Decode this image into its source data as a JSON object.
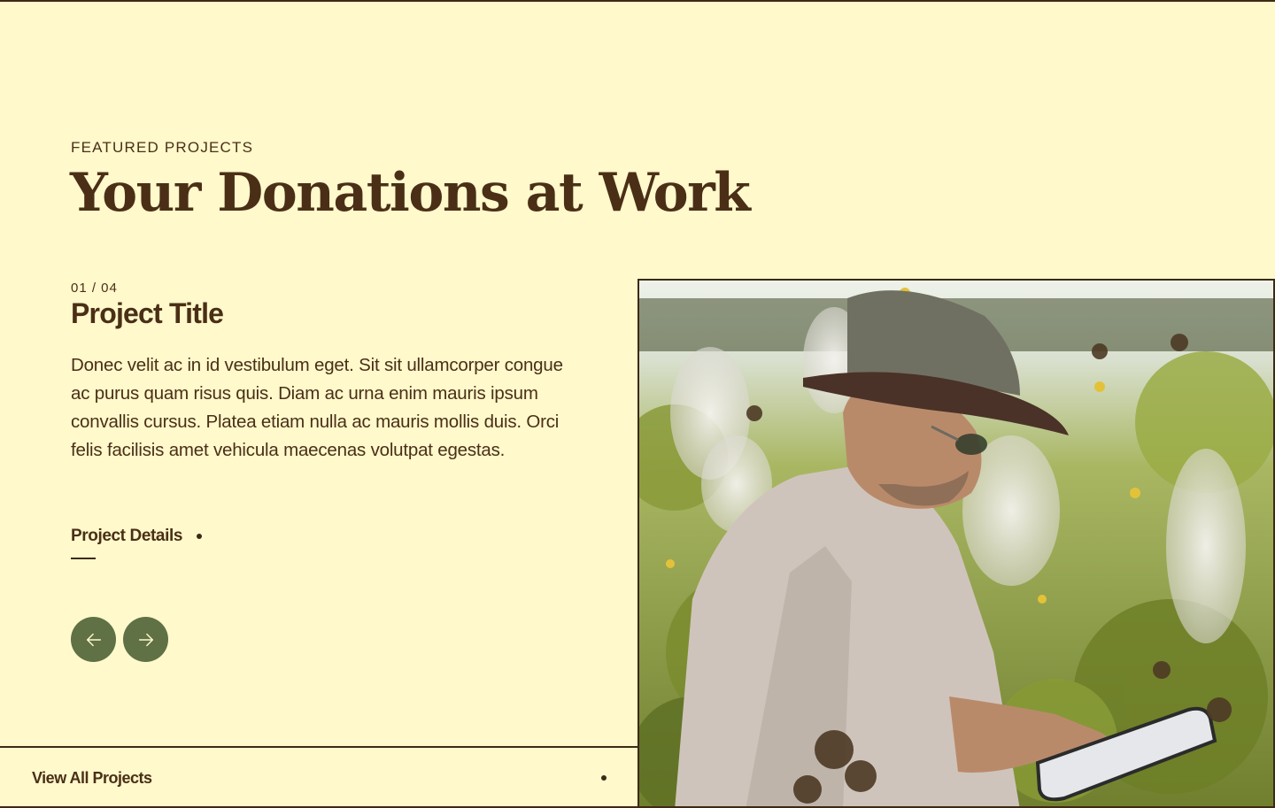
{
  "section": {
    "eyebrow": "FEATURED PROJECTS",
    "headline": "Your Donations at Work"
  },
  "project": {
    "counter": "01 / 04",
    "title": "Project Title",
    "body": "Donec velit ac in id vestibulum eget. Sit sit ullamcorper congue ac purus quam risus quis. Diam ac urna enim mauris ipsum convallis cursus. Platea etiam nulla ac mauris mollis duis. Orci felis facilisis amet vehicula maecenas volutpat egestas.",
    "details_label": "Project Details"
  },
  "carousel": {
    "prev_icon": "arrow-left-icon",
    "next_icon": "arrow-right-icon"
  },
  "footer": {
    "view_all_label": "View All Projects"
  },
  "colors": {
    "background": "#fff9cc",
    "text": "#4a2f16",
    "accent_green": "#5f7145",
    "rule": "#3d2a14"
  }
}
